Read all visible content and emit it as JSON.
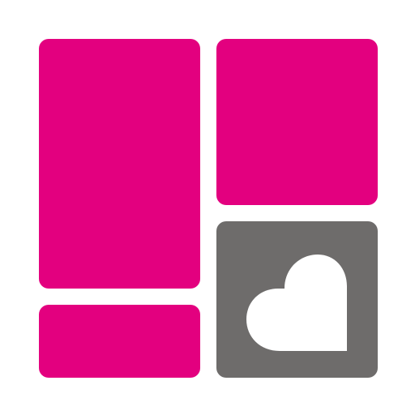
{
  "icon": {
    "name": "app-logo-icon",
    "colors": {
      "accent": "#E3007F",
      "dark_tile": "#6E6C6B",
      "background": "#FFFFFF",
      "heart": "#FFFFFF"
    },
    "tiles": [
      {
        "name": "tile-tall-left",
        "color_key": "accent"
      },
      {
        "name": "tile-top-right",
        "color_key": "accent"
      },
      {
        "name": "tile-bottom-left",
        "color_key": "accent"
      },
      {
        "name": "tile-bottom-right",
        "color_key": "dark_tile",
        "contains": "heart-icon"
      }
    ]
  }
}
